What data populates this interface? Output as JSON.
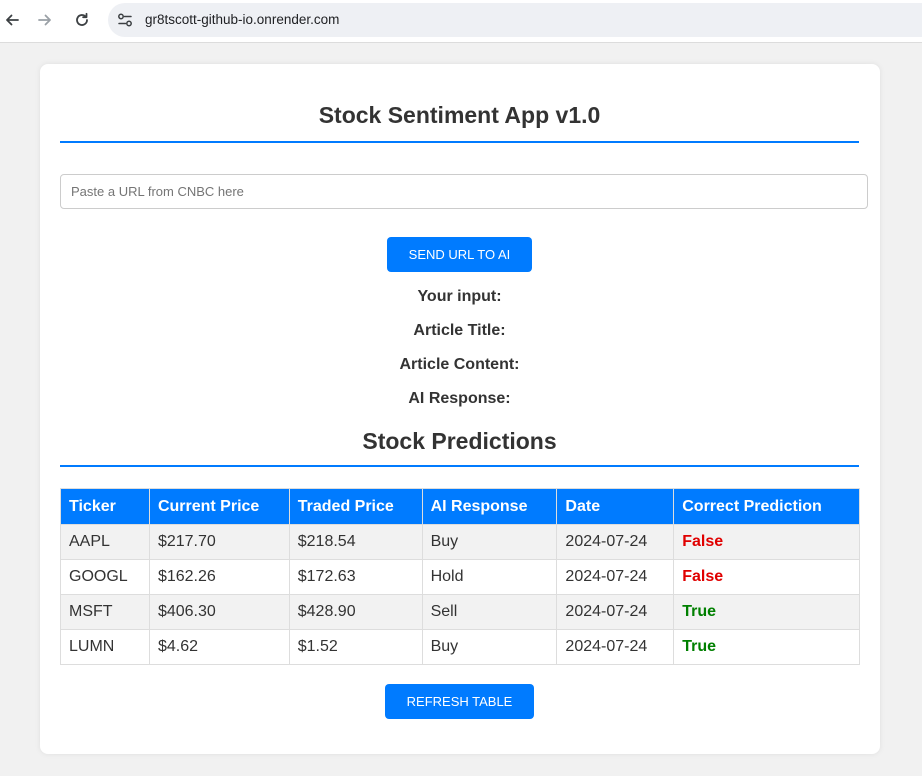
{
  "browser": {
    "url": "gr8tscott-github-io.onrender.com"
  },
  "app": {
    "title": "Stock Sentiment App v1.0",
    "url_input_placeholder": "Paste a URL from CNBC here",
    "url_input_value": "",
    "send_button_label": "SEND URL TO AI",
    "labels": {
      "your_input": "Your input:",
      "article_title": "Article Title:",
      "article_content": "Article Content:",
      "ai_response": "AI Response:"
    }
  },
  "predictions": {
    "title": "Stock Predictions",
    "columns": [
      "Ticker",
      "Current Price",
      "Traded Price",
      "AI Response",
      "Date",
      "Correct Prediction"
    ],
    "rows": [
      {
        "ticker": "AAPL",
        "current_price": "$217.70",
        "traded_price": "$218.54",
        "ai_response": "Buy",
        "date": "2024-07-24",
        "correct": "False"
      },
      {
        "ticker": "GOOGL",
        "current_price": "$162.26",
        "traded_price": "$172.63",
        "ai_response": "Hold",
        "date": "2024-07-24",
        "correct": "False"
      },
      {
        "ticker": "MSFT",
        "current_price": "$406.30",
        "traded_price": "$428.90",
        "ai_response": "Sell",
        "date": "2024-07-24",
        "correct": "True"
      },
      {
        "ticker": "LUMN",
        "current_price": "$4.62",
        "traded_price": "$1.52",
        "ai_response": "Buy",
        "date": "2024-07-24",
        "correct": "True"
      }
    ],
    "refresh_button_label": "REFRESH TABLE"
  },
  "colors": {
    "accent": "#007bff",
    "false": "#e00000",
    "true": "#008000"
  },
  "icons": {
    "back": "arrow-left-icon",
    "forward": "arrow-right-icon",
    "reload": "reload-icon",
    "site_info": "site-settings-icon"
  }
}
